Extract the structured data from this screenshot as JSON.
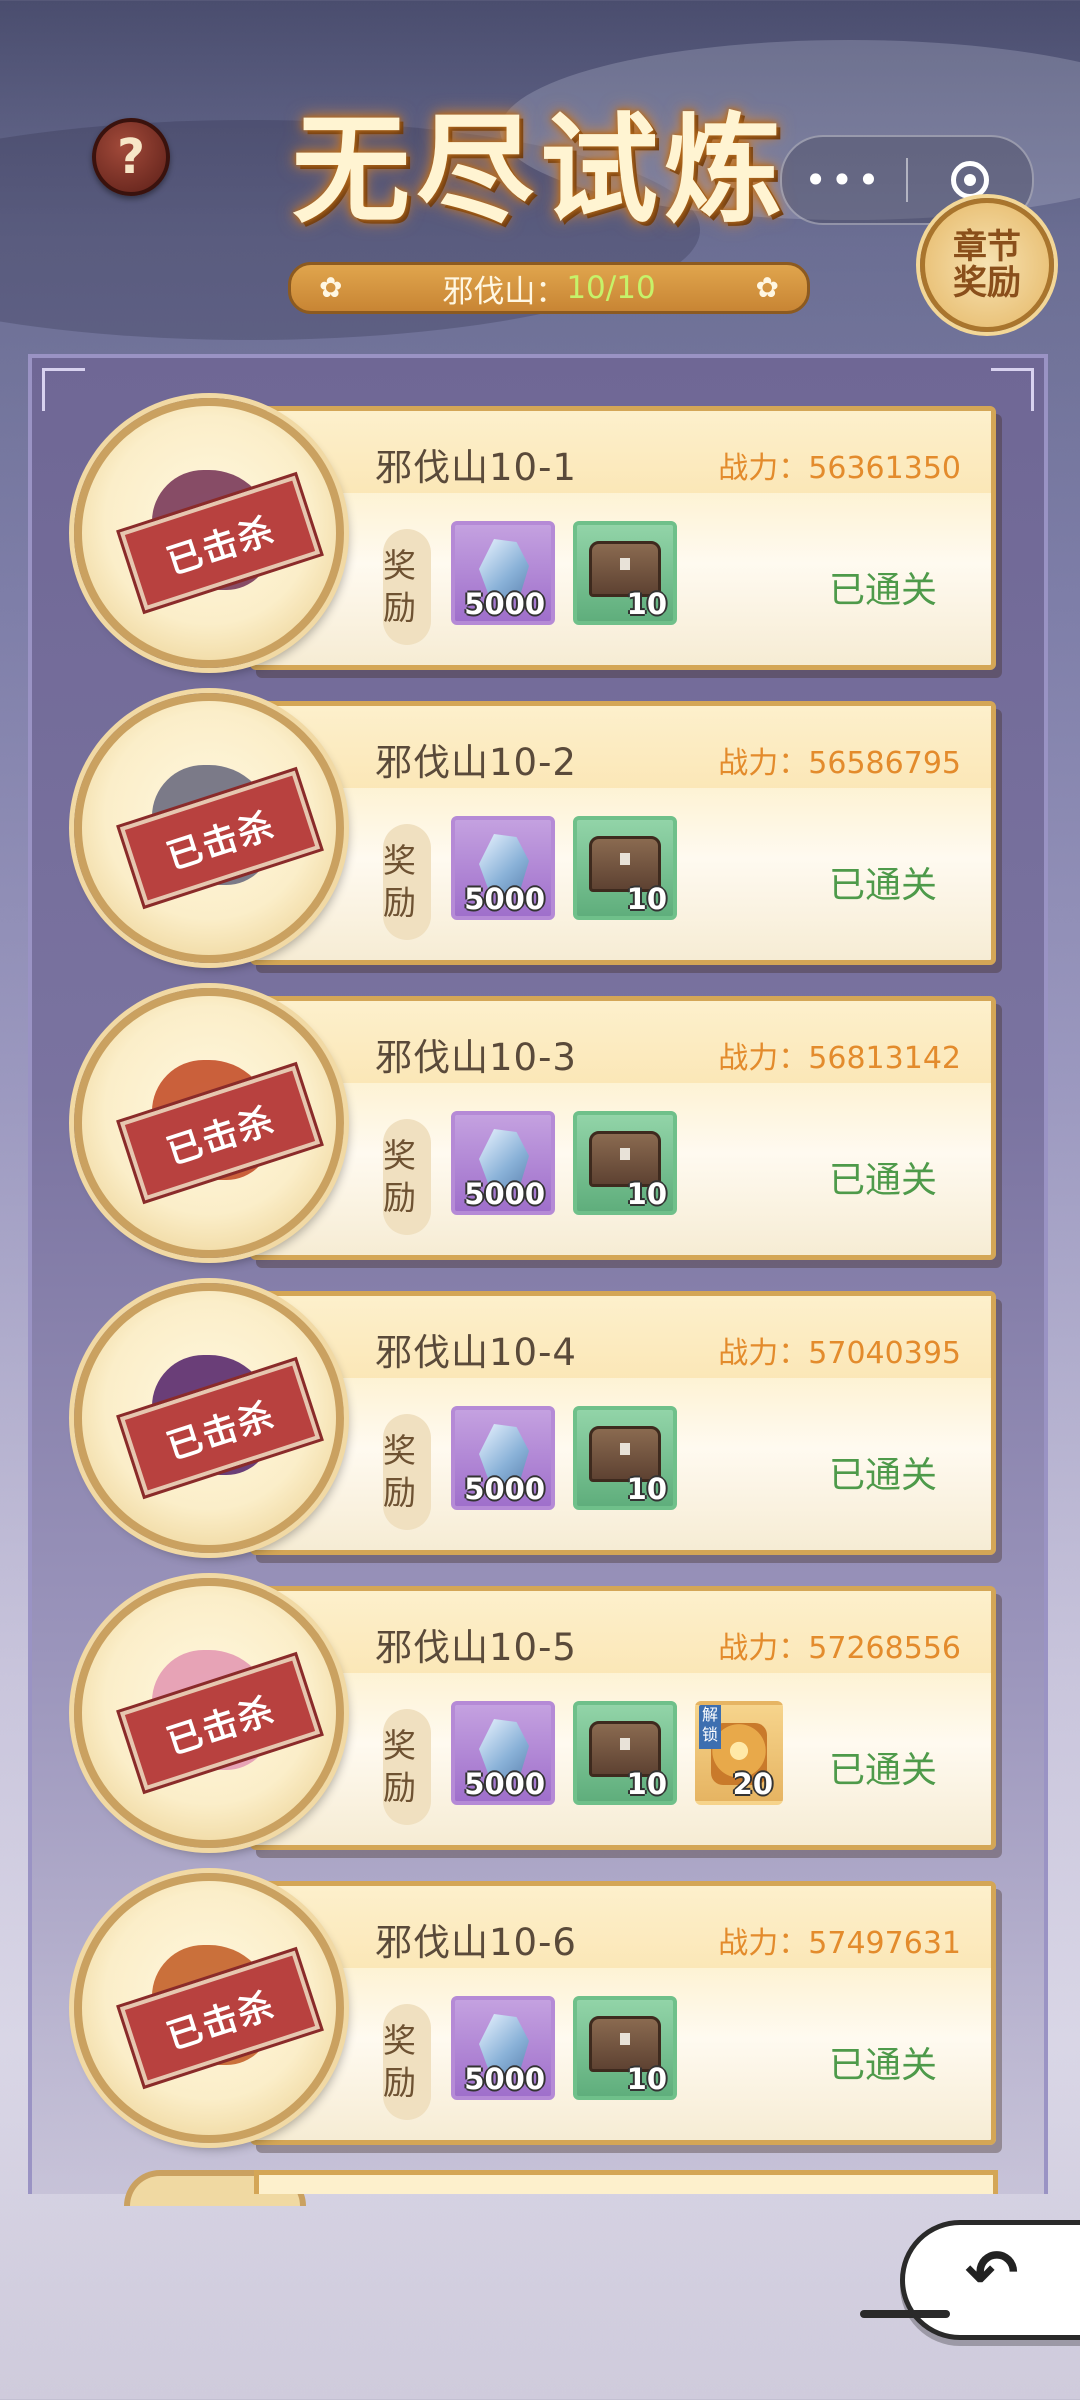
{
  "header": {
    "title": "无尽试炼",
    "help_icon": "?",
    "progress_label": "邪伐山：",
    "progress_value": "10/10",
    "chapter_reward": "章节奖励",
    "capsule_menu": "•••"
  },
  "stages": [
    {
      "name": "邪伐山10-1",
      "power": "战力：56361350",
      "reward_label": "奖励",
      "gem_count": "5000",
      "chest_count": "10",
      "status": "已通关",
      "stamp": "已击杀",
      "monster_color": "#7a3a5a"
    },
    {
      "name": "邪伐山10-2",
      "power": "战力：56586795",
      "reward_label": "奖励",
      "gem_count": "5000",
      "chest_count": "10",
      "status": "已通关",
      "stamp": "已击杀",
      "monster_color": "#6d6d80"
    },
    {
      "name": "邪伐山10-3",
      "power": "战力：56813142",
      "reward_label": "奖励",
      "gem_count": "5000",
      "chest_count": "10",
      "status": "已通关",
      "stamp": "已击杀",
      "monster_color": "#c4502a"
    },
    {
      "name": "邪伐山10-4",
      "power": "战力：57040395",
      "reward_label": "奖励",
      "gem_count": "5000",
      "chest_count": "10",
      "status": "已通关",
      "stamp": "已击杀",
      "monster_color": "#5a2a6e"
    },
    {
      "name": "邪伐山10-5",
      "power": "战力：57268556",
      "reward_label": "奖励",
      "gem_count": "5000",
      "chest_count": "10",
      "extra_count": "20",
      "extra_tag": "解锁",
      "status": "已通关",
      "stamp": "已击杀",
      "monster_color": "#e49ab3"
    },
    {
      "name": "邪伐山10-6",
      "power": "战力：57497631",
      "reward_label": "奖励",
      "gem_count": "5000",
      "chest_count": "10",
      "status": "已通关",
      "stamp": "已击杀",
      "monster_color": "#c4622a"
    }
  ],
  "icons": {
    "back": "back-arrow-icon",
    "gem": "gem-icon",
    "chest": "treasure-chest-icon",
    "scroll": "scroll-icon",
    "target": "target-icon"
  },
  "colors": {
    "power": "#e38b2c",
    "status": "#4e9a4a",
    "stamp": "#b8413f",
    "progress_value": "#c6f26a"
  }
}
